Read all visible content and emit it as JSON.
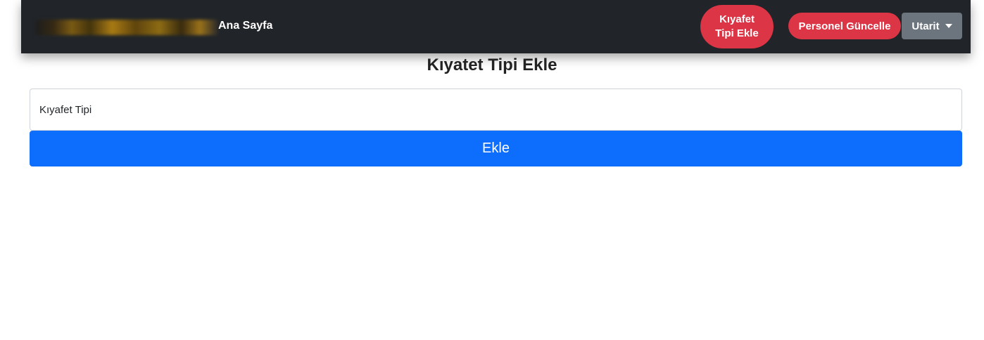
{
  "navbar": {
    "home_label": "Ana Sayfa",
    "kiyafet_btn_line1": "Kıyafet",
    "kiyafet_btn_line2": "Tipi Ekle",
    "personel_btn_label": "Personel Güncelle",
    "user_menu_label": "Utarit",
    "colors": {
      "background": "#212529",
      "danger": "#dc3545",
      "secondary": "#6c757d"
    }
  },
  "main": {
    "title": "Kıyatet Tipi Ekle",
    "input_placeholder": "Kıyafet Tipi",
    "input_value": "",
    "submit_label": "Ekle",
    "colors": {
      "primary": "#0d6efd"
    }
  }
}
